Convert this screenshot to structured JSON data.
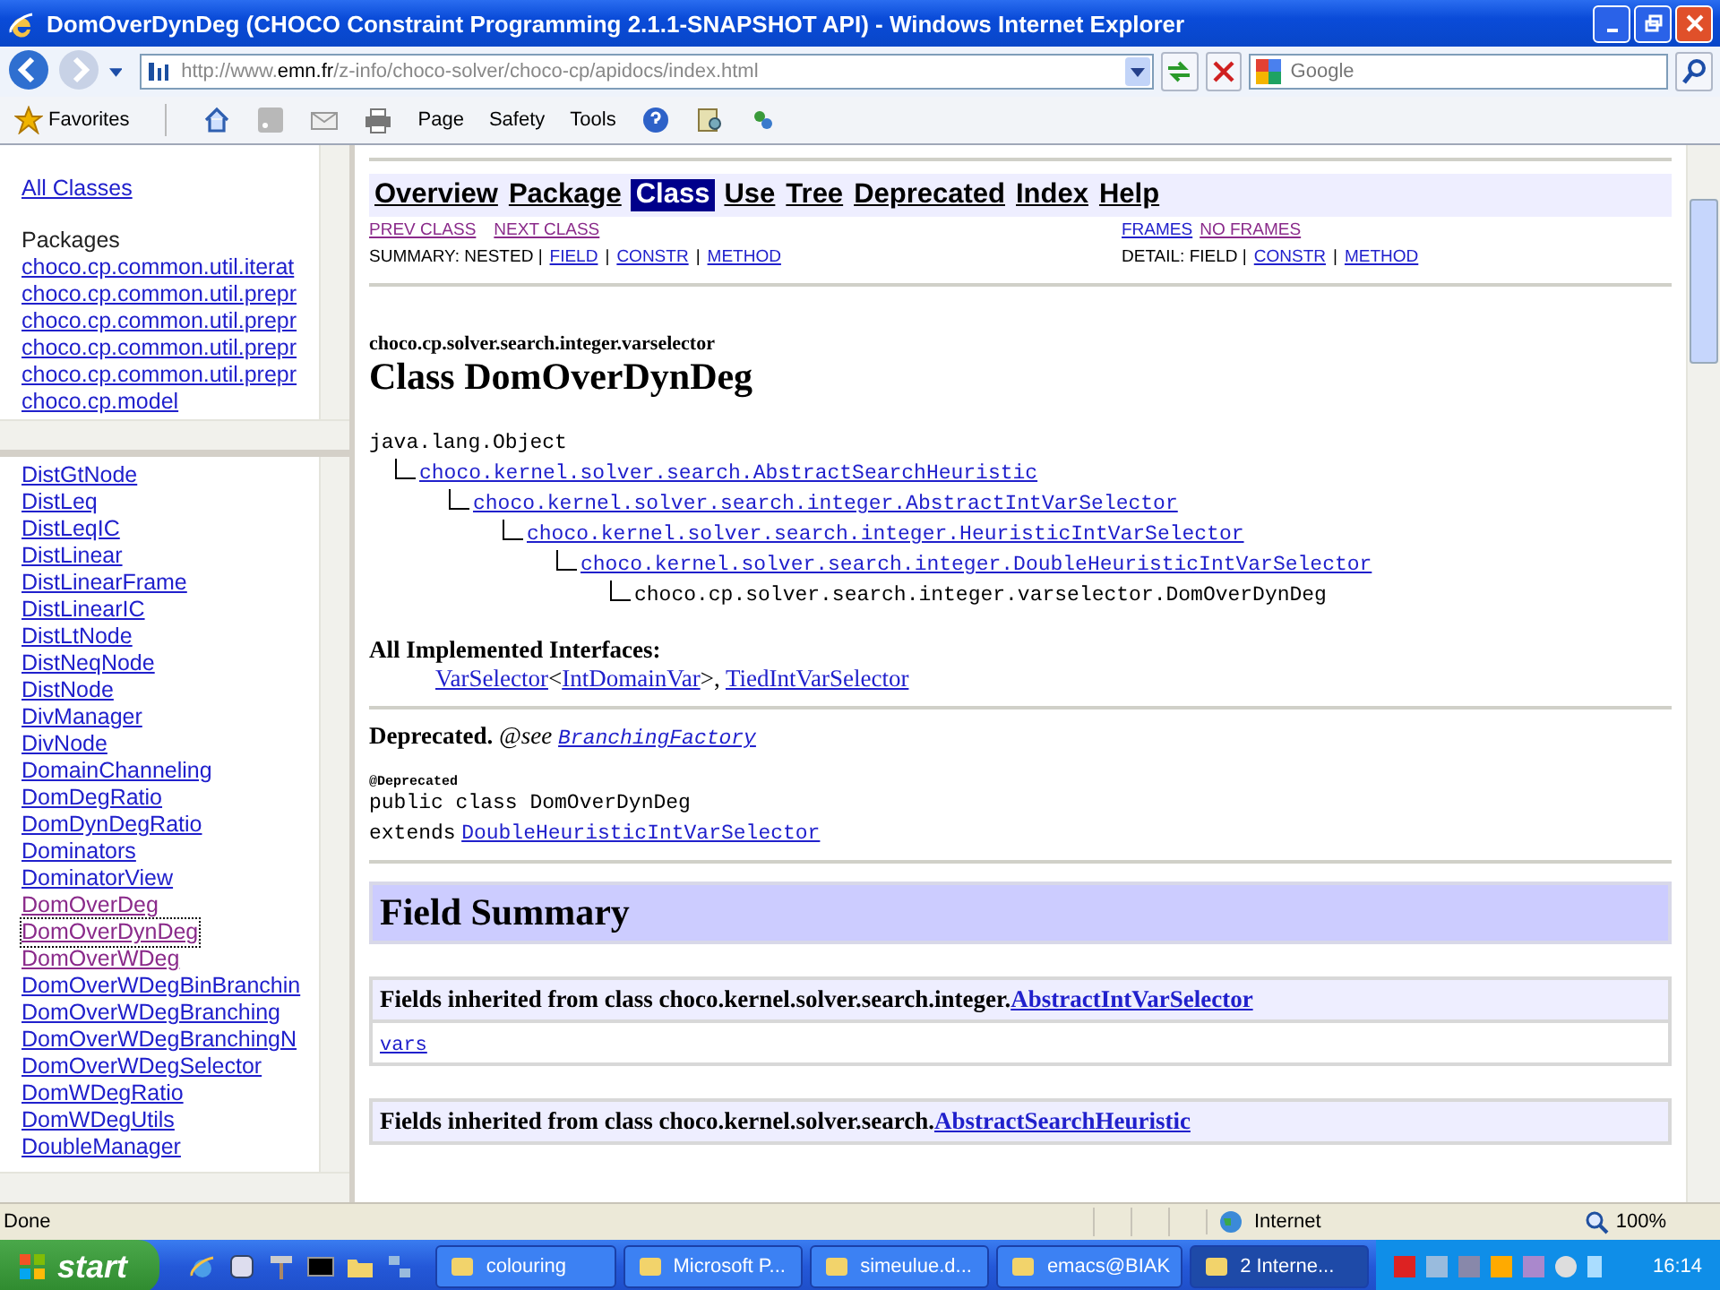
{
  "window": {
    "title": "DomOverDynDeg (CHOCO Constraint Programming 2.1.1-SNAPSHOT API) - Windows Internet Explorer"
  },
  "address_bar": {
    "url_prefix": "http://www.",
    "url_host": "emn.fr",
    "url_path": "/z-info/choco-solver/choco-cp/apidocs/index.html",
    "search_placeholder": "Google"
  },
  "command_bar": {
    "favorites": "Favorites",
    "menus": [
      "Page",
      "Safety",
      "Tools"
    ]
  },
  "packages_frame": {
    "all_classes": "All Classes",
    "heading": "Packages",
    "packages": [
      "choco.cp.common.util.iterat",
      "choco.cp.common.util.prepr",
      "choco.cp.common.util.prepr",
      "choco.cp.common.util.prepr",
      "choco.cp.common.util.prepr",
      "choco.cp.model"
    ]
  },
  "classes_frame": {
    "classes": [
      {
        "name": "DistGtNode",
        "visited": false,
        "selected": false
      },
      {
        "name": "DistLeq",
        "visited": false,
        "selected": false
      },
      {
        "name": "DistLeqIC",
        "visited": false,
        "selected": false
      },
      {
        "name": "DistLinear",
        "visited": false,
        "selected": false
      },
      {
        "name": "DistLinearFrame",
        "visited": false,
        "selected": false
      },
      {
        "name": "DistLinearIC",
        "visited": false,
        "selected": false
      },
      {
        "name": "DistLtNode",
        "visited": false,
        "selected": false
      },
      {
        "name": "DistNeqNode",
        "visited": false,
        "selected": false
      },
      {
        "name": "DistNode",
        "visited": false,
        "selected": false
      },
      {
        "name": "DivManager",
        "visited": false,
        "selected": false
      },
      {
        "name": "DivNode",
        "visited": false,
        "selected": false
      },
      {
        "name": "DomainChanneling",
        "visited": false,
        "selected": false
      },
      {
        "name": "DomDegRatio",
        "visited": false,
        "selected": false
      },
      {
        "name": "DomDynDegRatio",
        "visited": false,
        "selected": false
      },
      {
        "name": "Dominators",
        "visited": false,
        "selected": false
      },
      {
        "name": "DominatorView",
        "visited": false,
        "selected": false
      },
      {
        "name": "DomOverDeg",
        "visited": true,
        "selected": false
      },
      {
        "name": "DomOverDynDeg",
        "visited": true,
        "selected": true
      },
      {
        "name": "DomOverWDeg",
        "visited": true,
        "selected": false
      },
      {
        "name": "DomOverWDegBinBranchin",
        "visited": false,
        "selected": false
      },
      {
        "name": "DomOverWDegBranching",
        "visited": false,
        "selected": false
      },
      {
        "name": "DomOverWDegBranchingN",
        "visited": false,
        "selected": false
      },
      {
        "name": "DomOverWDegSelector",
        "visited": false,
        "selected": false
      },
      {
        "name": "DomWDegRatio",
        "visited": false,
        "selected": false
      },
      {
        "name": "DomWDegUtils",
        "visited": false,
        "selected": false
      },
      {
        "name": "DoubleManager",
        "visited": false,
        "selected": false
      }
    ]
  },
  "nav": {
    "items": [
      {
        "label": "Overview",
        "selected": false
      },
      {
        "label": "Package",
        "selected": false
      },
      {
        "label": "Class",
        "selected": true
      },
      {
        "label": "Use",
        "selected": false
      },
      {
        "label": "Tree",
        "selected": false
      },
      {
        "label": "Deprecated",
        "selected": false
      },
      {
        "label": "Index",
        "selected": false
      },
      {
        "label": "Help",
        "selected": false
      }
    ],
    "prev_class": "PREV CLASS",
    "next_class": "NEXT CLASS",
    "frames": "FRAMES",
    "no_frames": "NO FRAMES",
    "summary_label": "SUMMARY: NESTED |",
    "summary_links": [
      {
        "label": "FIELD",
        "separator": "|"
      },
      {
        "label": "CONSTR",
        "separator": "|"
      },
      {
        "label": "METHOD"
      }
    ],
    "detail_label": "DETAIL: FIELD |",
    "detail_links": [
      {
        "label": "CONSTR",
        "separator": "|"
      },
      {
        "label": "METHOD"
      }
    ]
  },
  "class_doc": {
    "package": "choco.cp.solver.search.integer.varselector",
    "title": "Class DomOverDynDeg",
    "hierarchy": {
      "name": "java.lang.Object",
      "link": false,
      "children": [
        {
          "name": "choco.kernel.solver.search.AbstractSearchHeuristic",
          "link": true,
          "children": [
            {
              "name": "choco.kernel.solver.search.integer.AbstractIntVarSelector",
              "link": true,
              "children": [
                {
                  "name": "choco.kernel.solver.search.integer.HeuristicIntVarSelector",
                  "link": true,
                  "children": [
                    {
                      "name": "choco.kernel.solver.search.integer.DoubleHeuristicIntVarSelector",
                      "link": true,
                      "children": [
                        {
                          "name": "choco.cp.solver.search.integer.varselector.DomOverDynDeg",
                          "link": false
                        }
                      ]
                    }
                  ]
                }
              ]
            }
          ]
        }
      ]
    },
    "interfaces_heading": "All Implemented Interfaces:",
    "interfaces": [
      {
        "text": "VarSelector",
        "link": true
      },
      {
        "text": "<",
        "link": false
      },
      {
        "text": "IntDomainVar",
        "link": true
      },
      {
        "text": ">, ",
        "link": false
      },
      {
        "text": "TiedIntVarSelector",
        "link": true
      }
    ],
    "deprecated_label": "Deprecated.",
    "see_label": "@see",
    "see_link": "BranchingFactory",
    "annotation": "@Deprecated",
    "declaration": "public class DomOverDynDeg",
    "extends_label": "extends",
    "extends_link": "DoubleHeuristicIntVarSelector",
    "field_summary": "Field Summary",
    "inherited": [
      {
        "prefix": "Fields inherited from class choco.kernel.solver.search.integer.",
        "link": "AbstractIntVarSelector",
        "fields": [
          "vars"
        ]
      },
      {
        "prefix": "Fields inherited from class choco.kernel.solver.search.",
        "link": "AbstractSearchHeuristic"
      }
    ]
  },
  "status_bar": {
    "text": "Done",
    "zone": "Internet",
    "zoom": "100%"
  },
  "taskbar": {
    "start": "start",
    "tasks": [
      {
        "label": "colouring",
        "selected": false
      },
      {
        "label": "Microsoft P...",
        "selected": false
      },
      {
        "label": "simeulue.d...",
        "selected": false
      },
      {
        "label": "emacs@BIAK",
        "selected": false
      },
      {
        "label": "2 Interne...",
        "selected": true
      }
    ],
    "clock": "16:14"
  }
}
